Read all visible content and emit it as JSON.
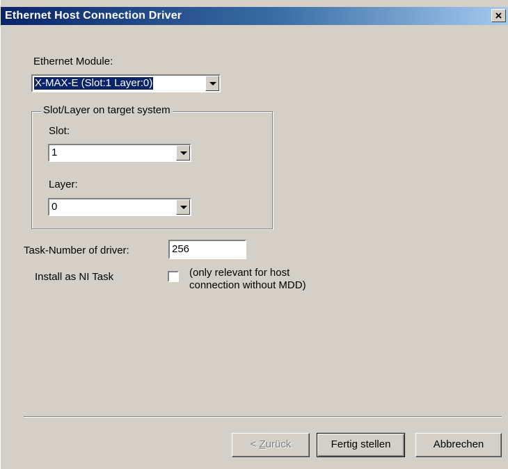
{
  "window": {
    "title": "Ethernet Host Connection Driver",
    "close_glyph": "×"
  },
  "ethernet_module": {
    "label": "Ethernet Module:",
    "value": "X-MAX-E (Slot:1 Layer:0)"
  },
  "slot_layer_group": {
    "legend": "Slot/Layer on target system",
    "slot_label": "Slot:",
    "slot_value": "1",
    "layer_label": "Layer:",
    "layer_value": "0"
  },
  "task_number": {
    "label": "Task-Number of driver:",
    "value": "256"
  },
  "install_ni_task": {
    "label": "Install as NI Task",
    "checked": false,
    "note_line1": "(only relevant for host",
    "note_line2": "connection without MDD)"
  },
  "buttons": {
    "back_prefix": "< ",
    "back_underlined": "Z",
    "back_rest": "urück",
    "finish": "Fertig stellen",
    "cancel": "Abbrechen"
  },
  "colors": {
    "face": "#d4d0c8",
    "title_start": "#0a246a",
    "title_end": "#a6caf0",
    "selection": "#0a246a"
  }
}
